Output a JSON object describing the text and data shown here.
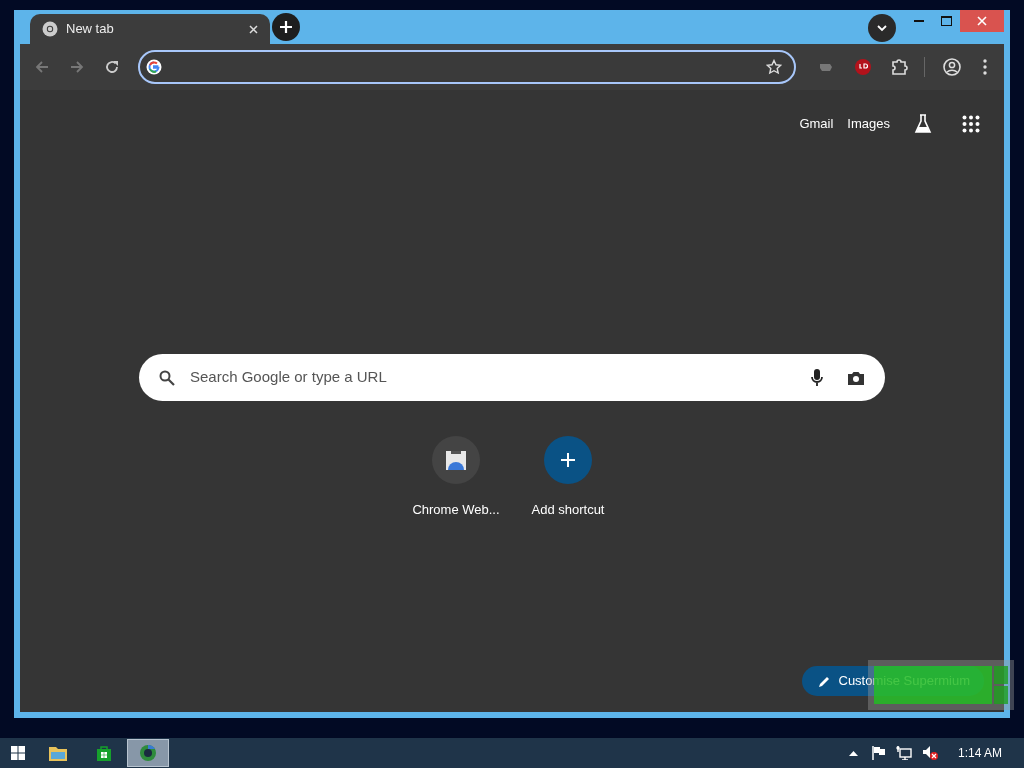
{
  "tabs": [
    {
      "title": "New tab",
      "selected": true
    }
  ],
  "new_tab_page": {
    "top_links": [
      "Gmail",
      "Images"
    ],
    "search": {
      "placeholder": "Search Google or type a URL"
    },
    "shortcuts": [
      {
        "kind": "site",
        "label": "Chrome Web..."
      },
      {
        "kind": "add",
        "label": "Add shortcut"
      }
    ],
    "customise_button": "Customise Supermium"
  },
  "taskbar": {
    "apps": [
      {
        "kind": "explorer",
        "selected": false
      },
      {
        "kind": "store",
        "selected": false
      },
      {
        "kind": "browser",
        "selected": true
      }
    ],
    "clock": "1:14 AM"
  }
}
